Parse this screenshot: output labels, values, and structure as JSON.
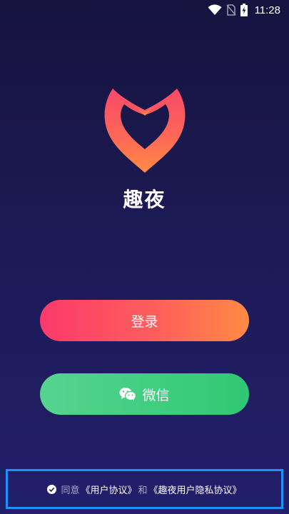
{
  "status_bar": {
    "time": "11:28",
    "icons": [
      "wifi-icon",
      "no-sim-icon",
      "battery-charging-icon"
    ]
  },
  "app": {
    "name": "趣夜",
    "logo": "heart-fox-logo"
  },
  "buttons": {
    "login_label": "登录",
    "wechat_label": "微信",
    "wechat_icon": "wechat-icon"
  },
  "agreement": {
    "check_icon": "check-circle-icon",
    "prefix": "同意",
    "user_agreement": "《用户协议》",
    "conjunction": "和",
    "privacy_agreement": "《趣夜用户隐私协议》"
  },
  "colors": {
    "background_top": "#16133f",
    "background_bottom": "#221f6b",
    "login_gradient_start": "#fb3a6b",
    "login_gradient_end": "#ff8a45",
    "wechat_gradient_start": "#56d48f",
    "wechat_gradient_end": "#2fc873",
    "highlight_border": "#1e90ff"
  }
}
